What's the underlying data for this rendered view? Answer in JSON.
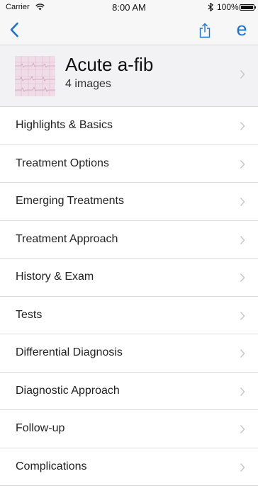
{
  "status_bar": {
    "carrier": "Carrier",
    "time": "8:00 AM",
    "battery": "100%"
  },
  "nav": {
    "back_icon": "chevron-left-icon",
    "share_icon": "share-icon",
    "e_label": "e",
    "tint": "#1a74d6"
  },
  "header": {
    "title": "Acute a-fib",
    "subtitle": "4 images"
  },
  "menu": {
    "items": [
      {
        "label": "Highlights & Basics"
      },
      {
        "label": "Treatment Options"
      },
      {
        "label": "Emerging Treatments"
      },
      {
        "label": "Treatment Approach"
      },
      {
        "label": "History & Exam"
      },
      {
        "label": "Tests"
      },
      {
        "label": "Differential Diagnosis"
      },
      {
        "label": "Diagnostic Approach"
      },
      {
        "label": "Follow-up"
      },
      {
        "label": "Complications"
      }
    ]
  }
}
